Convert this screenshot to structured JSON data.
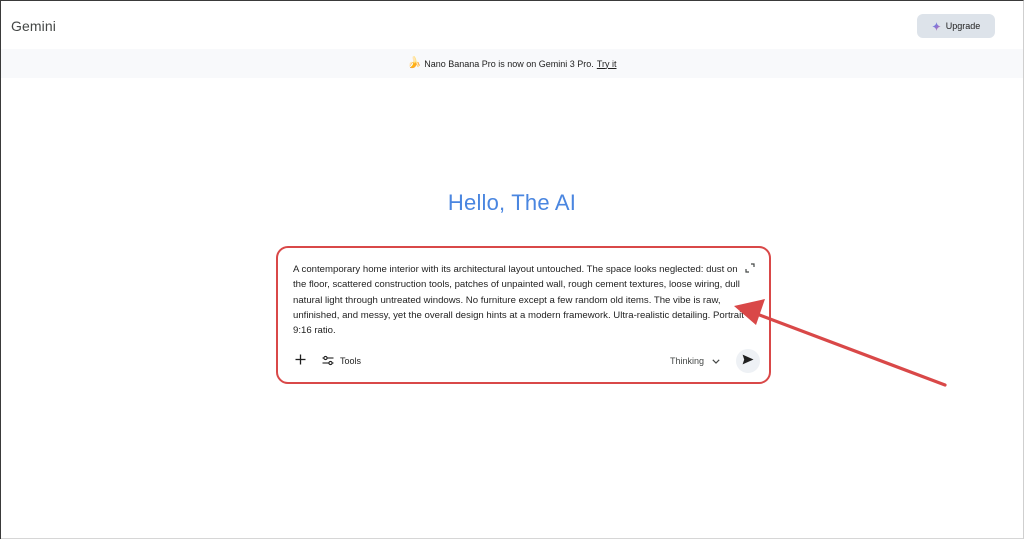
{
  "header": {
    "app_title": "Gemini",
    "upgrade_label": "Upgrade",
    "upgrade_icon": "sparkle-icon"
  },
  "banner": {
    "emoji": "🍌",
    "message": "Nano Banana Pro is now on Gemini 3 Pro.",
    "link_label": "Try it"
  },
  "greeting": "Hello, The AI",
  "composer": {
    "prompt_value": "A contemporary home interior with its architectural layout untouched. The space looks neglected: dust on the floor, scattered construction tools, patches of unpainted wall, rough cement textures, loose wiring, dull natural light through untreated windows. No furniture except a few random old items. The vibe is raw, unfinished, and messy, yet the overall design hints at a modern framework. Ultra-realistic detailing. Portrait 9:16 ratio.",
    "tools_label": "Tools",
    "mode_label": "Thinking",
    "icons": {
      "add": "plus-icon",
      "tools": "sliders-icon",
      "mode": "chevron-down-icon",
      "send": "send-icon",
      "expand": "expand-icon"
    }
  },
  "colors": {
    "greeting": "#4a86e0",
    "annotation": "#d94848",
    "upgrade_bg": "#dde3ea",
    "banner_bg": "#f8f9fb"
  }
}
